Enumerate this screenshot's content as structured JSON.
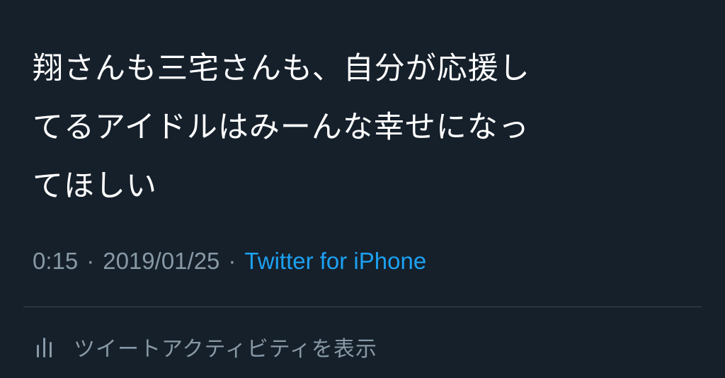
{
  "tweet": {
    "text_lines": [
      "翔さんも三宅さんも、自分が応援し",
      "てるアイドルはみーんな幸せになっ",
      "てほしい"
    ],
    "time": "0:15",
    "separator": "·",
    "date": "2019/01/25",
    "source": "Twitter for iPhone"
  },
  "activity": {
    "icon": "bar-chart-icon",
    "label": "ツイートアクティビティを表示"
  },
  "colors": {
    "background": "#15202b",
    "text": "#ffffff",
    "muted": "#8899a6",
    "link": "#1da1f2",
    "divider": "#38444d"
  }
}
